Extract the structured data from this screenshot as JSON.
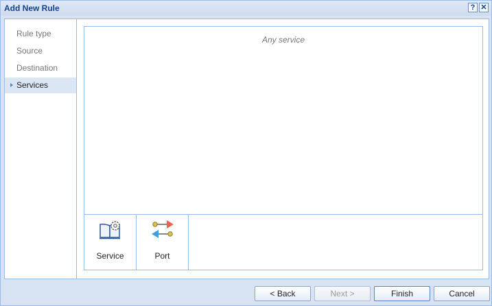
{
  "window": {
    "title": "Add New Rule",
    "help_glyph": "?",
    "close_glyph": "✕"
  },
  "nav": {
    "items": [
      {
        "label": "Rule type"
      },
      {
        "label": "Source"
      },
      {
        "label": "Destination"
      },
      {
        "label": "Services",
        "active": true
      }
    ]
  },
  "content": {
    "empty_text": "Any service"
  },
  "palette": {
    "items": [
      {
        "label": "Service",
        "icon": "service-icon"
      },
      {
        "label": "Port",
        "icon": "port-icon"
      }
    ]
  },
  "footer": {
    "back_label": "< Back",
    "next_label": "Next >",
    "finish_label": "Finish",
    "cancel_label": "Cancel"
  },
  "colors": {
    "accent": "#15428b",
    "border": "#99bbe8",
    "active_bg": "#dbe6f5"
  }
}
